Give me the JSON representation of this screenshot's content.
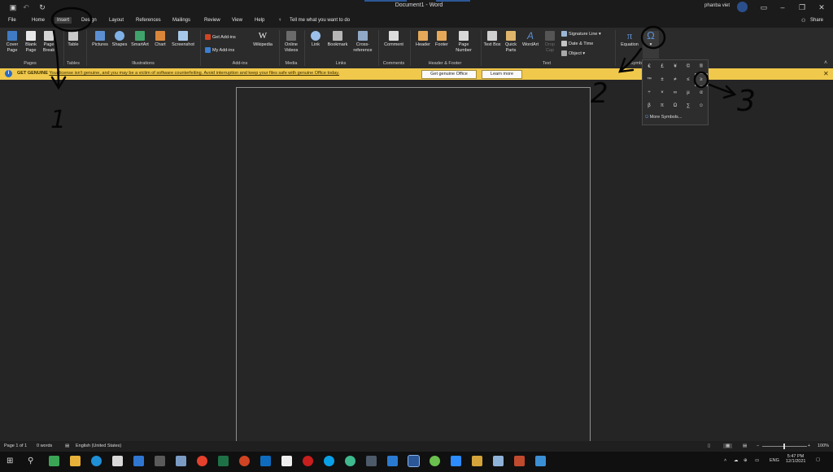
{
  "window": {
    "title": "Document1 - Word",
    "user": "phanba viet",
    "share_label": "Share"
  },
  "menu": {
    "items": [
      "File",
      "Home",
      "Insert",
      "Design",
      "Layout",
      "References",
      "Mailings",
      "Review",
      "View",
      "Help"
    ],
    "active": "Insert",
    "tell_me": "Tell me what you want to do"
  },
  "ribbon": {
    "pages": {
      "group": "Pages",
      "cover_page": "Cover Page",
      "blank_page": "Blank Page",
      "page_break": "Page Break"
    },
    "tables": {
      "group": "Tables",
      "table": "Table"
    },
    "illustrations": {
      "group": "Illustrations",
      "pictures": "Pictures",
      "shapes": "Shapes",
      "smartart": "SmartArt",
      "chart": "Chart",
      "screenshot": "Screenshot"
    },
    "addins": {
      "group": "Add-ins",
      "get_addins": "Get Add-ins",
      "my_addins": "My Add-ins",
      "wikipedia": "Wikipedia"
    },
    "media": {
      "group": "Media",
      "online_videos": "Online Videos"
    },
    "links": {
      "group": "Links",
      "link": "Link",
      "bookmark": "Bookmark",
      "cross_reference": "Cross-reference"
    },
    "comments": {
      "group": "Comments",
      "comment": "Comment"
    },
    "header_footer": {
      "group": "Header & Footer",
      "header": "Header",
      "footer": "Footer",
      "page_number": "Page Number"
    },
    "text": {
      "group": "Text",
      "text_box": "Text Box",
      "quick_parts": "Quick Parts",
      "wordart": "WordArt",
      "drop_cap": "Drop Cap",
      "signature_line": "Signature Line",
      "date_time": "Date & Time",
      "object": "Object"
    },
    "symbols": {
      "group": "Symb",
      "equation": "Equation"
    }
  },
  "banner": {
    "prefix": "GET GENUINE",
    "message": "Your license isn't genuine, and you may be a victim of software counterfeiting. Avoid interruption and keep your files safe with genuine Office today.",
    "btn_genuine": "Get genuine Office",
    "btn_learn": "Learn more"
  },
  "symbols_dropdown": {
    "rows": [
      [
        "€",
        "£",
        "¥",
        "©",
        "®"
      ],
      [
        "™",
        "±",
        "≠",
        "≤",
        "≥"
      ],
      [
        "÷",
        "×",
        "∞",
        "µ",
        "α"
      ],
      [
        "β",
        "π",
        "Ω",
        "∑",
        "☺"
      ]
    ],
    "more": "More Symbols..."
  },
  "status": {
    "page": "Page 1 of 1",
    "words": "0 words",
    "language": "English (United States)",
    "zoom": "100%"
  },
  "tray": {
    "lang": "ENG",
    "time": "5:47 PM",
    "date": "12/1/2021"
  },
  "annotations": [
    "1",
    "2",
    "3"
  ],
  "colors": {
    "word_blue": "#2b5797",
    "banner_yellow": "#f0c84b",
    "excel_green": "#1e7145",
    "ppt_orange": "#d04423"
  }
}
